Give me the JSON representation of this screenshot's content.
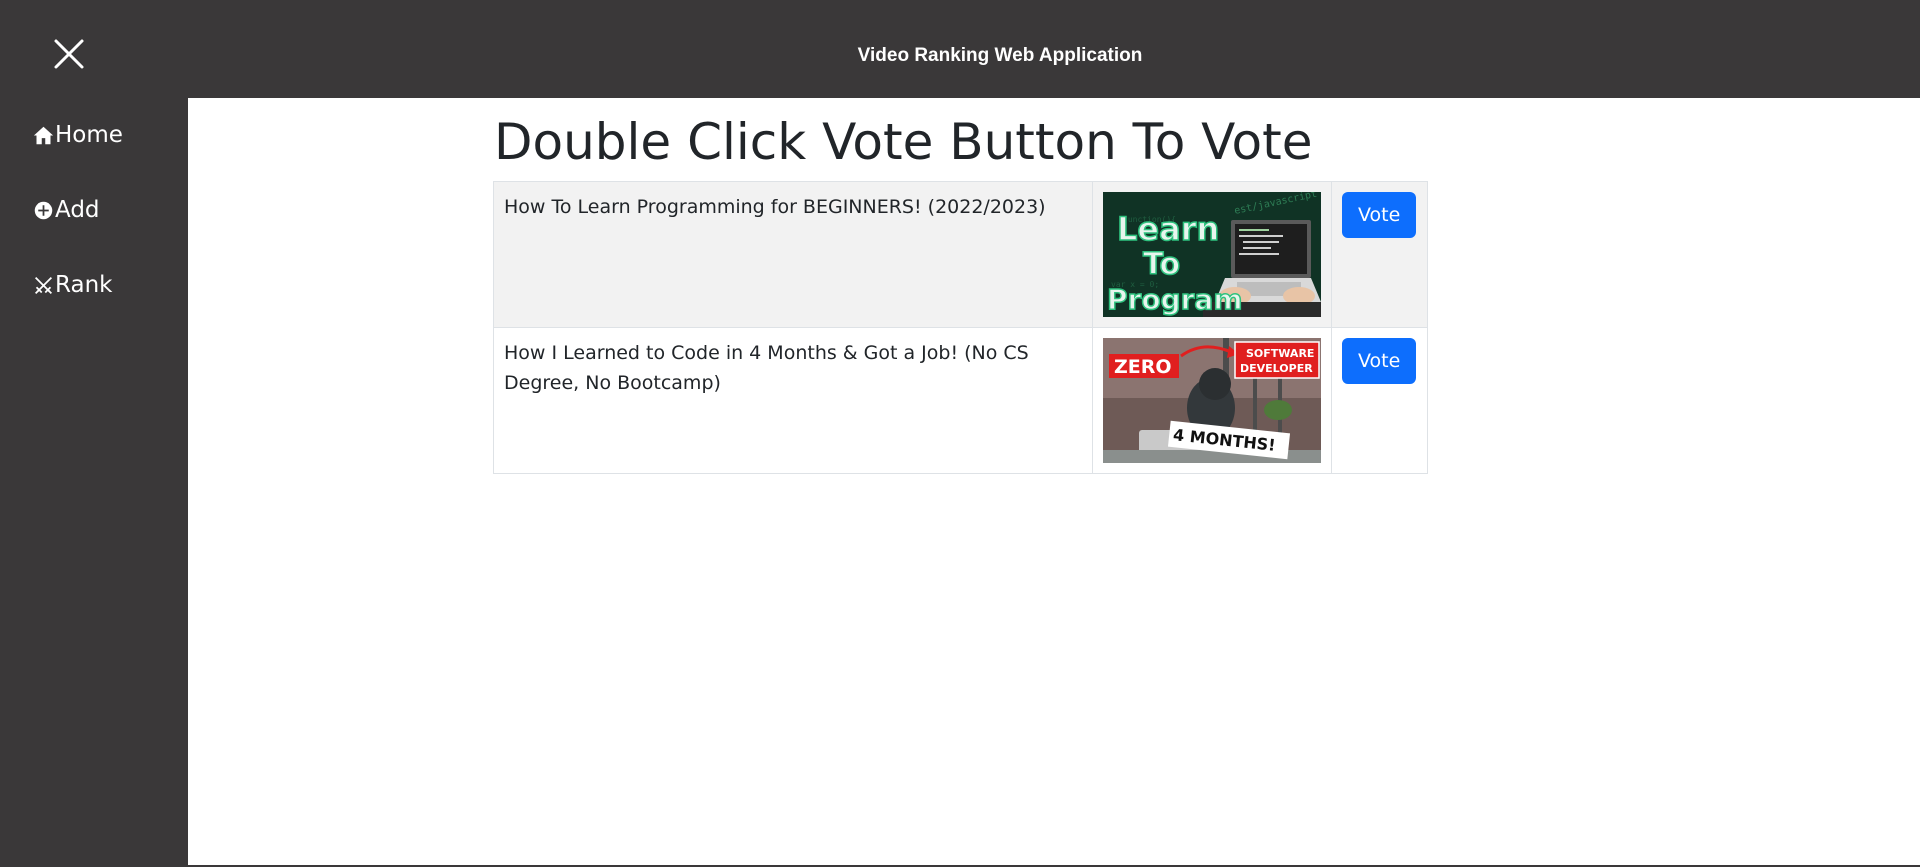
{
  "header": {
    "title": "Video Ranking Web Application",
    "close_icon": "close-icon"
  },
  "sidebar": {
    "items": [
      {
        "label": "Home",
        "icon": "home-icon"
      },
      {
        "label": "Add",
        "icon": "plus-circle-icon"
      },
      {
        "label": "Rank",
        "icon": "swords-icon"
      }
    ]
  },
  "main": {
    "heading": "Double Click Vote Button To Vote",
    "videos": [
      {
        "title": "How To Learn Programming for BEGINNERS! (2022/2023)",
        "thumbnail_text": [
          "Learn",
          "To",
          "Program"
        ],
        "vote_label": "Vote"
      },
      {
        "title": "How I Learned to Code in 4 Months & Got a Job! (No CS Degree, No Bootcamp)",
        "thumbnail_text": [
          "ZERO",
          "SOFTWARE",
          "DEVELOPER",
          "4 MONTHS!"
        ],
        "vote_label": "Vote"
      }
    ]
  },
  "colors": {
    "sidebar_bg": "#3a3839",
    "vote_button": "#0d6efd",
    "row_stripe": "#f2f2f2"
  }
}
